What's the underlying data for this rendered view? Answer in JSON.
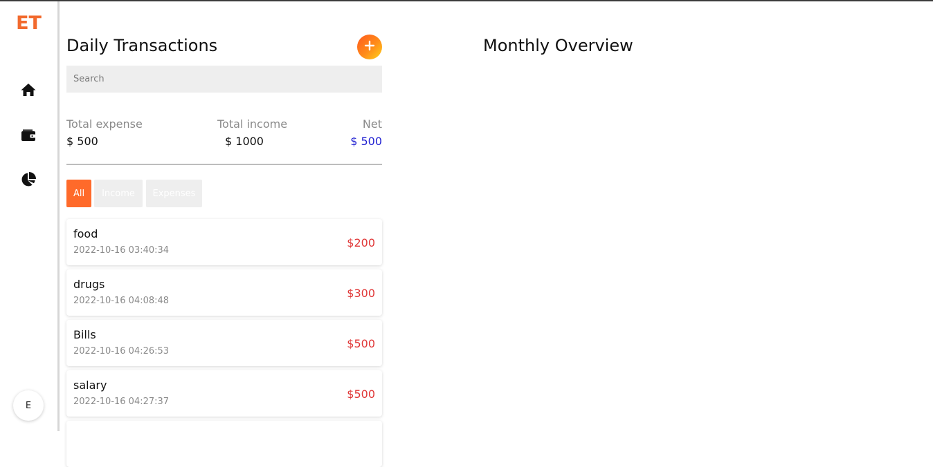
{
  "app": {
    "logo": "ET",
    "avatar_initial": "E"
  },
  "sidebar": {
    "items": [
      {
        "icon": "home-icon"
      },
      {
        "icon": "wallet-icon"
      },
      {
        "icon": "pie-chart-icon"
      }
    ]
  },
  "daily": {
    "title": "Daily Transactions",
    "add_label": "+",
    "search_placeholder": "Search",
    "summary": {
      "expense_label": "Total expense",
      "expense_value": "$ 500",
      "income_label": "Total income",
      "income_value": "$ 1000",
      "net_label": "Net",
      "net_value": "$ 500"
    },
    "filters": [
      {
        "label": "All",
        "active": true
      },
      {
        "label": "Income",
        "active": false
      },
      {
        "label": "Expenses",
        "active": false
      }
    ],
    "transactions": [
      {
        "category": "food",
        "datetime": "2022-10-16 03:40:34",
        "amount": "$200"
      },
      {
        "category": "drugs",
        "datetime": "2022-10-16 04:08:48",
        "amount": "$300"
      },
      {
        "category": "Bills",
        "datetime": "2022-10-16 04:26:53",
        "amount": "$500"
      },
      {
        "category": "salary",
        "datetime": "2022-10-16 04:27:37",
        "amount": "$500"
      },
      {
        "category": "",
        "datetime": "",
        "amount": ""
      }
    ]
  },
  "monthly": {
    "title": "Monthly Overview"
  },
  "colors": {
    "accent": "#f26a2e",
    "expense": "#e03535",
    "net": "#1f1fd1",
    "filter_inactive_bg": "#eeeeee",
    "filter_inactive_text": "#ffffff"
  }
}
